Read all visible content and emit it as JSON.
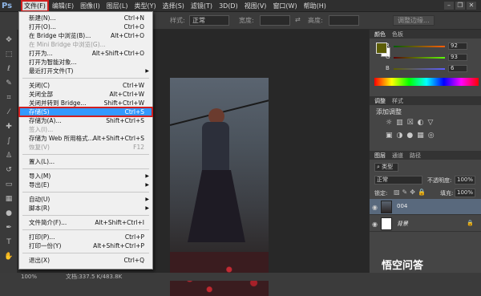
{
  "app": {
    "logo": "Ps"
  },
  "menubar": {
    "items": [
      "文件(F)",
      "编辑(E)",
      "图像(I)",
      "图层(L)",
      "类型(Y)",
      "选择(S)",
      "滤镜(T)",
      "3D(D)",
      "视图(V)",
      "窗口(W)",
      "帮助(H)"
    ],
    "active_index": 0
  },
  "window_controls": {
    "minimize": "–",
    "restore": "❐",
    "close": "✕"
  },
  "options_bar": {
    "style_label": "样式:",
    "style_value": "正常",
    "width_label": "宽度:",
    "height_label": "高度:",
    "refine_edge": "调整边缘..."
  },
  "file_menu": [
    {
      "label": "新建(N)...",
      "shortcut": "Ctrl+N"
    },
    {
      "label": "打开(O)...",
      "shortcut": "Ctrl+O"
    },
    {
      "label": "在 Bridge 中浏览(B)...",
      "shortcut": "Alt+Ctrl+O"
    },
    {
      "label": "在 Mini Bridge 中浏览(G)...",
      "shortcut": "",
      "disabled": true
    },
    {
      "label": "打开为...",
      "shortcut": "Alt+Shift+Ctrl+O"
    },
    {
      "label": "打开为智能对象...",
      "shortcut": ""
    },
    {
      "label": "最近打开文件(T)",
      "shortcut": "",
      "submenu": true
    },
    {
      "sep": true
    },
    {
      "label": "关闭(C)",
      "shortcut": "Ctrl+W"
    },
    {
      "label": "关闭全部",
      "shortcut": "Alt+Ctrl+W"
    },
    {
      "label": "关闭并转到 Bridge...",
      "shortcut": "Shift+Ctrl+W"
    },
    {
      "label": "存储(S)",
      "shortcut": "Ctrl+S",
      "selected": true
    },
    {
      "label": "存储为(A)...",
      "shortcut": "Shift+Ctrl+S"
    },
    {
      "label": "签入(I)...",
      "shortcut": "",
      "disabled": true
    },
    {
      "label": "存储为 Web 所用格式...",
      "shortcut": "Alt+Shift+Ctrl+S"
    },
    {
      "label": "恢复(V)",
      "shortcut": "F12",
      "disabled": true
    },
    {
      "sep": true
    },
    {
      "label": "置入(L)...",
      "shortcut": ""
    },
    {
      "sep": true
    },
    {
      "label": "导入(M)",
      "shortcut": "",
      "submenu": true
    },
    {
      "label": "导出(E)",
      "shortcut": "",
      "submenu": true
    },
    {
      "sep": true
    },
    {
      "label": "自动(U)",
      "shortcut": "",
      "submenu": true
    },
    {
      "label": "脚本(R)",
      "shortcut": "",
      "submenu": true
    },
    {
      "sep": true
    },
    {
      "label": "文件简介(F)...",
      "shortcut": "Alt+Shift+Ctrl+I"
    },
    {
      "sep": true
    },
    {
      "label": "打印(P)...",
      "shortcut": "Ctrl+P"
    },
    {
      "label": "打印一份(Y)",
      "shortcut": "Alt+Shift+Ctrl+P"
    },
    {
      "sep": true
    },
    {
      "label": "退出(X)",
      "shortcut": "Ctrl+Q"
    }
  ],
  "status_bar": {
    "zoom": "100%",
    "doc_info": "文档:337.5 K/483.8K"
  },
  "color_panel": {
    "tabs": [
      "颜色",
      "色板"
    ],
    "channels": [
      {
        "name": "R",
        "value": "92"
      },
      {
        "name": "G",
        "value": "93"
      },
      {
        "name": "B",
        "value": "6"
      }
    ],
    "fg_color": "#5c5d06"
  },
  "adjust_panel": {
    "tabs": [
      "调整",
      "样式"
    ],
    "title": "添加调整"
  },
  "layers_panel": {
    "tabs": [
      "图层",
      "通道",
      "路径"
    ],
    "filter_label": "类型",
    "blend_mode": "正常",
    "opacity_label": "不透明度:",
    "opacity_value": "100%",
    "lock_label": "锁定:",
    "fill_label": "填充:",
    "fill_value": "100%",
    "layers": [
      {
        "name": "004",
        "selected": true
      },
      {
        "name": "背景",
        "locked": true
      }
    ]
  },
  "watermark": {
    "text": "悟空问答"
  }
}
